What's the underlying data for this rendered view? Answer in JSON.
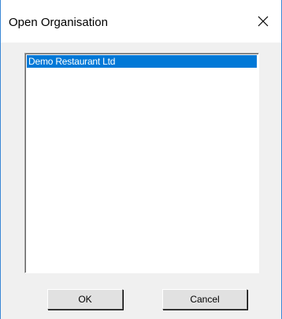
{
  "window": {
    "title": "Open Organisation",
    "close_icon": "close-icon"
  },
  "organisation_list": {
    "items": [
      {
        "label": "Demo Restaurant Ltd",
        "selected": true
      }
    ]
  },
  "buttons": {
    "ok_label": "OK",
    "cancel_label": "Cancel"
  },
  "colors": {
    "selection": "#0078d7",
    "window_border": "#3b88d6",
    "dialog_background": "#f0f0f0"
  }
}
